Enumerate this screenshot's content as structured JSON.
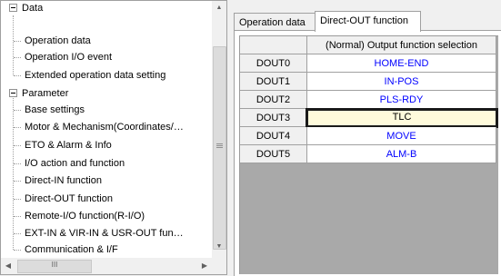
{
  "tree": {
    "items": [
      {
        "label": "Data",
        "level": 0,
        "expanded": true
      },
      {
        "label": "Operation data",
        "level": 1
      },
      {
        "label": "Operation I/O event",
        "level": 1
      },
      {
        "label": "Extended operation data setting",
        "level": 1
      },
      {
        "label": "Parameter",
        "level": 0,
        "expanded": true
      },
      {
        "label": "Base settings",
        "level": 1
      },
      {
        "label": "Motor & Mechanism(Coordinates/…",
        "level": 1
      },
      {
        "label": "ETO & Alarm & Info",
        "level": 1
      },
      {
        "label": "I/O action and function",
        "level": 1
      },
      {
        "label": "Direct-IN function",
        "level": 1
      },
      {
        "label": "Direct-OUT function",
        "level": 1,
        "selected": true
      },
      {
        "label": "Remote-I/O function(R-I/O)",
        "level": 1
      },
      {
        "label": "EXT-IN & VIR-IN & USR-OUT fun…",
        "level": 1
      },
      {
        "label": "Communication & I/F",
        "level": 1
      }
    ],
    "hscroll_thumb_glyph": "III"
  },
  "tabs": [
    {
      "label": "Operation data",
      "active": false
    },
    {
      "label": "Direct-OUT function",
      "active": true
    }
  ],
  "grid": {
    "column_header": "(Normal) Output function selection",
    "rows": [
      {
        "name": "DOUT0",
        "value": "HOME-END"
      },
      {
        "name": "DOUT1",
        "value": "IN-POS"
      },
      {
        "name": "DOUT2",
        "value": "PLS-RDY"
      },
      {
        "name": "DOUT3",
        "value": "TLC",
        "current": true
      },
      {
        "name": "DOUT4",
        "value": "MOVE"
      },
      {
        "name": "DOUT5",
        "value": "ALM-B"
      }
    ]
  },
  "colors": {
    "value_text": "#0000ff",
    "current_cell_bg": "#fffbdc",
    "grid_empty_bg": "#a9a9a9"
  }
}
